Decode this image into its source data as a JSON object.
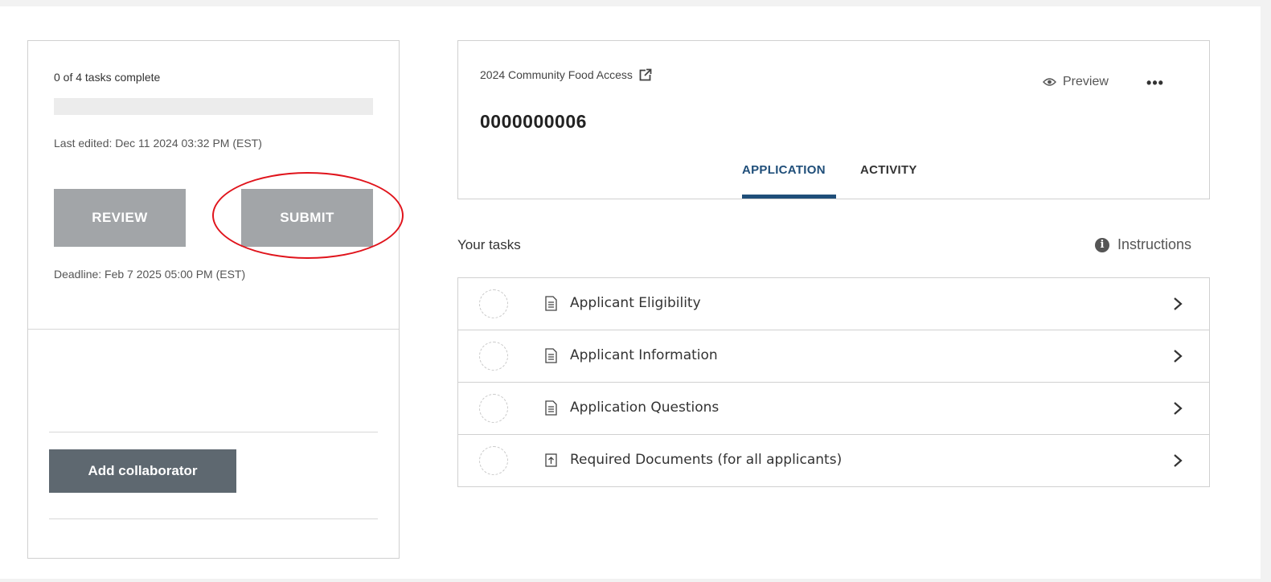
{
  "sidebar": {
    "progress_text": "0 of 4 tasks complete",
    "progress_fraction": 0,
    "last_edited": "Last edited: Dec 11 2024 03:32 PM (EST)",
    "review_label": "REVIEW",
    "submit_label": "SUBMIT",
    "deadline": "Deadline: Feb 7 2025 05:00 PM (EST)",
    "add_collaborator_label": "Add collaborator"
  },
  "header": {
    "program_name": "2024 Community Food Access",
    "application_number": "0000000006",
    "preview_label": "Preview",
    "more_label": "•••",
    "tabs": [
      {
        "label": "APPLICATION",
        "active": true
      },
      {
        "label": "ACTIVITY",
        "active": false
      }
    ]
  },
  "tasks": {
    "heading": "Your tasks",
    "instructions_label": "Instructions",
    "items": [
      {
        "label": "Applicant Eligibility",
        "icon": "document-icon",
        "status": "not-started"
      },
      {
        "label": "Applicant Information",
        "icon": "document-icon",
        "status": "not-started"
      },
      {
        "label": "Application Questions",
        "icon": "document-icon",
        "status": "not-started"
      },
      {
        "label": "Required Documents (for all applicants)",
        "icon": "upload-icon",
        "status": "not-started"
      }
    ]
  },
  "colors": {
    "accent": "#1f4e79",
    "button_disabled": "#a2a5a8",
    "button_dark": "#5e6870",
    "highlight": "#e0141c"
  }
}
